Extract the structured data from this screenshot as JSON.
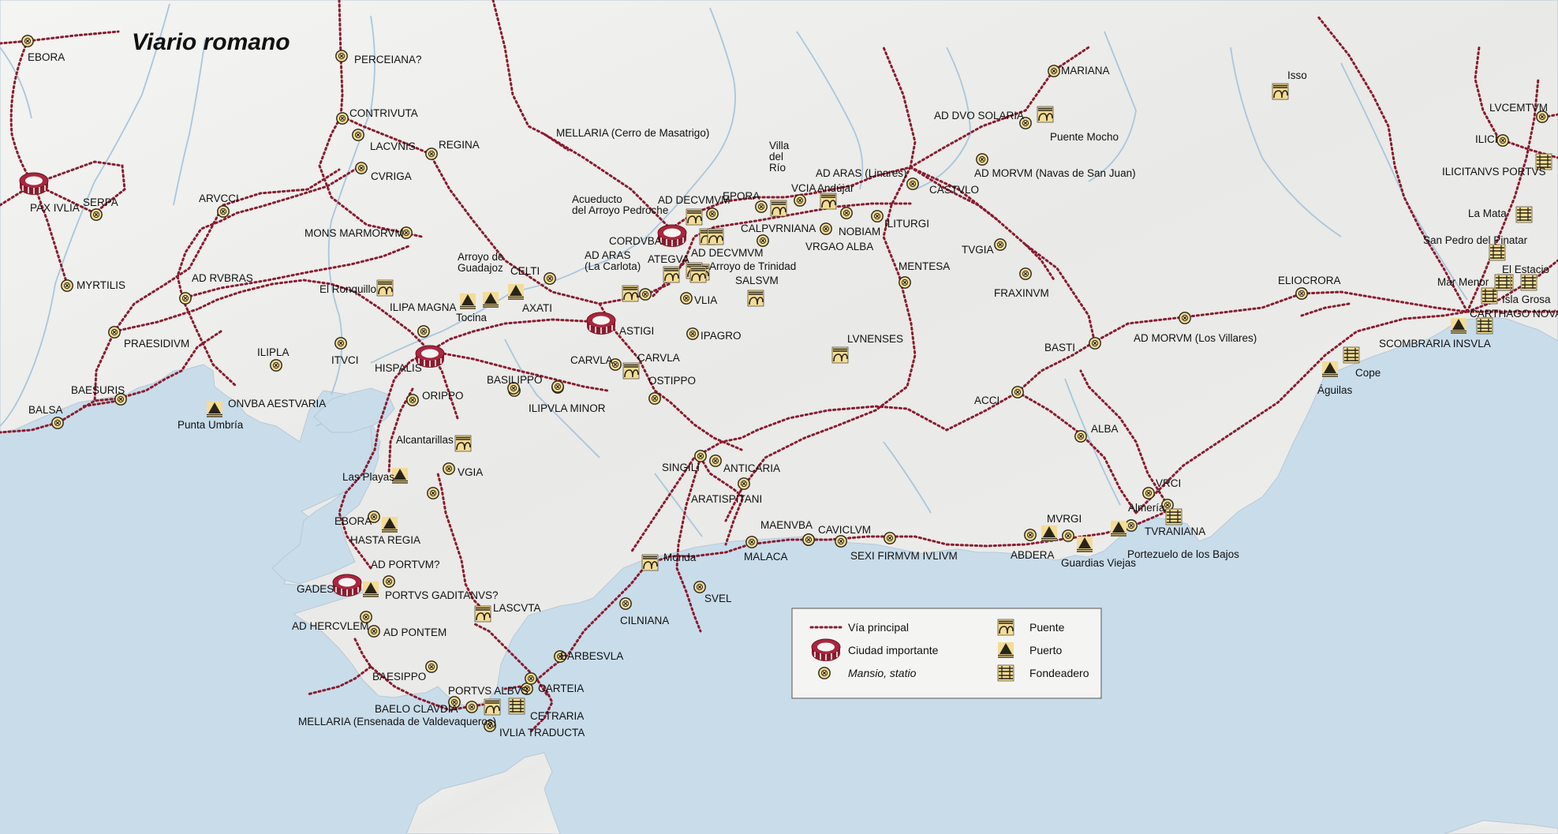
{
  "title": "Viario romano",
  "colors": {
    "sea": "#c9dcea",
    "land": "#efefed",
    "road": "#8a1c2f",
    "city": "#8a1c2f",
    "mansio_fill": "#f3dc96",
    "icon_fill": "#f3dc96",
    "icon_stroke": "#2a2416",
    "river": "#a9c6dd"
  },
  "places": [
    {
      "id": "ebora",
      "label": "EBORA"
    },
    {
      "id": "perceiana",
      "label": "PERCEIANA?"
    },
    {
      "id": "contrivuta",
      "label": "CONTRIVUTA"
    },
    {
      "id": "lacvnis",
      "label": "LACVNIS"
    },
    {
      "id": "regina",
      "label": "REGINA"
    },
    {
      "id": "cvriga",
      "label": "CVRIGA"
    },
    {
      "id": "paxivlia",
      "label": "PAX IVLIA"
    },
    {
      "id": "serpa",
      "label": "SERPA"
    },
    {
      "id": "arvcci",
      "label": "ARVCCI"
    },
    {
      "id": "monsmarmorvm",
      "label": "MONS MARMORVM"
    },
    {
      "id": "myrtilis",
      "label": "MYRTILIS"
    },
    {
      "id": "adrvbras",
      "label": "AD RVBRAS"
    },
    {
      "id": "elronquillo",
      "label": "El Ronquillo"
    },
    {
      "id": "arroyoguadajoz",
      "label": "Arroyo de\nGuadajoz"
    },
    {
      "id": "celti",
      "label": "CELTI"
    },
    {
      "id": "tocina",
      "label": "Tocina"
    },
    {
      "id": "axati",
      "label": "AXATI"
    },
    {
      "id": "ilipamagna",
      "label": "ILIPA MAGNA"
    },
    {
      "id": "praesidivm",
      "label": "PRAESIDIVM"
    },
    {
      "id": "ilipla",
      "label": "ILIPLA"
    },
    {
      "id": "itvci",
      "label": "ITVCI"
    },
    {
      "id": "hispalis",
      "label": "HISPALIS"
    },
    {
      "id": "baesuris",
      "label": "BAESURIS"
    },
    {
      "id": "onvba",
      "label": "ONVBA AESTVARIA"
    },
    {
      "id": "balsa",
      "label": "BALSA"
    },
    {
      "id": "puntaumbria",
      "label": "Punta Umbría"
    },
    {
      "id": "orippo",
      "label": "ORIPPO"
    },
    {
      "id": "basilippo",
      "label": "BASILIPPO"
    },
    {
      "id": "alcantarillas",
      "label": "Alcantarillas"
    },
    {
      "id": "vgia",
      "label": "VGIA"
    },
    {
      "id": "lasplayas",
      "label": "Las Playas"
    },
    {
      "id": "ebora2",
      "label": "EBORA"
    },
    {
      "id": "hastaregia",
      "label": "HASTA REGIA"
    },
    {
      "id": "adportvm",
      "label": "AD PORTVM?"
    },
    {
      "id": "gades",
      "label": "GADES"
    },
    {
      "id": "portvsgaditanvs",
      "label": "PORTVS GADITANVS?"
    },
    {
      "id": "adhercvlem",
      "label": "AD HERCVLEM"
    },
    {
      "id": "adpontem",
      "label": "AD PONTEM"
    },
    {
      "id": "baesippo",
      "label": "BAESIPPO"
    },
    {
      "id": "portvsalbvs",
      "label": "PORTVS ALBVS"
    },
    {
      "id": "baeloclaudia",
      "label": "BAELO CLAVDIA"
    },
    {
      "id": "mellaria2",
      "label": "MELLARIA (Ensenada de Valdevaqueros)"
    },
    {
      "id": "ivliatraducta",
      "label": "IVLIA TRADUCTA"
    },
    {
      "id": "cetraria",
      "label": "CETRARIA"
    },
    {
      "id": "carteia",
      "label": "CARTEIA"
    },
    {
      "id": "barbesvla",
      "label": "BARBESVLA"
    },
    {
      "id": "lascvta",
      "label": "LASCVTA"
    },
    {
      "id": "cilniana",
      "label": "CILNIANA"
    },
    {
      "id": "svel",
      "label": "SVEL"
    },
    {
      "id": "monda",
      "label": "Monda"
    },
    {
      "id": "malaca",
      "label": "MALACA"
    },
    {
      "id": "maenvba",
      "label": "MAENVBA"
    },
    {
      "id": "caviclvm",
      "label": "CAVICLVM"
    },
    {
      "id": "sexi",
      "label": "SEXI FIRMVM IVLIVM"
    },
    {
      "id": "abdera",
      "label": "ABDERA"
    },
    {
      "id": "mvrgi",
      "label": "MVRGI"
    },
    {
      "id": "guardiasviejas",
      "label": "Guardias Viejas"
    },
    {
      "id": "portezuelo",
      "label": "Portezuelo de los Bajos"
    },
    {
      "id": "tvraniana",
      "label": "TVRANIANA"
    },
    {
      "id": "almeria",
      "label": "Almería"
    },
    {
      "id": "vrci",
      "label": "VRCI"
    },
    {
      "id": "alba",
      "label": "ALBA"
    },
    {
      "id": "acci",
      "label": "ACCI"
    },
    {
      "id": "basti",
      "label": "BASTI"
    },
    {
      "id": "admorvmvillares",
      "label": "AD MORVM (Los Villares)"
    },
    {
      "id": "eliocroca",
      "label": "ELIOCRORA"
    },
    {
      "id": "carthagonova",
      "label": "CARTHAGO NOVA"
    },
    {
      "id": "scombraria",
      "label": "SCOMBRARIA INSVLA"
    },
    {
      "id": "cope",
      "label": "Cope"
    },
    {
      "id": "aguilas",
      "label": "Águilas"
    },
    {
      "id": "marmenor",
      "label": "Mar Menor"
    },
    {
      "id": "islagrosa",
      "label": "Isla Grosa"
    },
    {
      "id": "elestacio",
      "label": "El Estacio"
    },
    {
      "id": "sanpedro",
      "label": "San Pedro del Pinatar"
    },
    {
      "id": "lamata",
      "label": "La Mata"
    },
    {
      "id": "ilicitanvs",
      "label": "ILICITANVS PORTVS"
    },
    {
      "id": "ilici",
      "label": "ILICI"
    },
    {
      "id": "lvcemtvm",
      "label": "LVCEMTVM"
    },
    {
      "id": "isso",
      "label": "Isso"
    },
    {
      "id": "mariana",
      "label": "MARIANA"
    },
    {
      "id": "addvosolaria",
      "label": "AD DVO SOLARIA"
    },
    {
      "id": "puentemocho",
      "label": "Puente Mocho"
    },
    {
      "id": "admorvmnavas",
      "label": "AD MORVM (Navas de San Juan)"
    },
    {
      "id": "castvlo",
      "label": "CASTVLO"
    },
    {
      "id": "adaraslinares",
      "label": "AD ARAS (Linares)"
    },
    {
      "id": "andujar",
      "label": "Andújar"
    },
    {
      "id": "villadelrio",
      "label": "Villa\ndel\nRío"
    },
    {
      "id": "vcia",
      "label": "VCIA"
    },
    {
      "id": "epora",
      "label": "EPORA"
    },
    {
      "id": "addecvmvm",
      "label": "AD DECVMVM"
    },
    {
      "id": "acueducto",
      "label": "Acueducto\ndel Arroyo Pedroche"
    },
    {
      "id": "cordvba",
      "label": "CORDVBA"
    },
    {
      "id": "calpvrniana",
      "label": "CALPVRNIANA"
    },
    {
      "id": "nobiam",
      "label": "NOBIAM"
    },
    {
      "id": "ilitvrgi",
      "label": "ILITURGI"
    },
    {
      "id": "vrgaoalba",
      "label": "VRGAO ALBA"
    },
    {
      "id": "tvgia",
      "label": "TVGIA"
    },
    {
      "id": "fraxinvm",
      "label": "FRAXINVM"
    },
    {
      "id": "mentesa",
      "label": "MENTESA"
    },
    {
      "id": "lvnenses",
      "label": "LVNENSES"
    },
    {
      "id": "mellaria1",
      "label": "MELLARIA (Cerro de Masatrigo)"
    },
    {
      "id": "addecvmvm2",
      "label": "AD DECVMVM"
    },
    {
      "id": "ategva",
      "label": "ATEGVA"
    },
    {
      "id": "arroyotrinidad",
      "label": "Arroyo de Trinidad"
    },
    {
      "id": "salsvm",
      "label": "SALSVM"
    },
    {
      "id": "vlia",
      "label": "VLIA"
    },
    {
      "id": "adaraslacarlota",
      "label": "AD ARAS\n(La Carlota)"
    },
    {
      "id": "astigi",
      "label": "ASTIGI"
    },
    {
      "id": "ipagro",
      "label": "IPAGRO"
    },
    {
      "id": "carvla1",
      "label": "CARVLA"
    },
    {
      "id": "carvla2",
      "label": "CARVLA"
    },
    {
      "id": "ostippo",
      "label": "OSTIPPO"
    },
    {
      "id": "ilipvlaminor",
      "label": "ILIPVLA MINOR"
    },
    {
      "id": "singili",
      "label": "SINGILI"
    },
    {
      "id": "anticaria",
      "label": "ANTICARIA"
    },
    {
      "id": "aratispitani",
      "label": "ARATISPITANI"
    }
  ],
  "legend": {
    "items": [
      {
        "symbol": "road",
        "label": "Vía principal"
      },
      {
        "symbol": "city",
        "label": "Ciudad importante"
      },
      {
        "symbol": "mansio",
        "label": "Mansio, statio"
      },
      {
        "symbol": "bridge",
        "label": "Puente"
      },
      {
        "symbol": "port",
        "label": "Puerto"
      },
      {
        "symbol": "anchorage",
        "label": "Fondeadero"
      }
    ]
  }
}
